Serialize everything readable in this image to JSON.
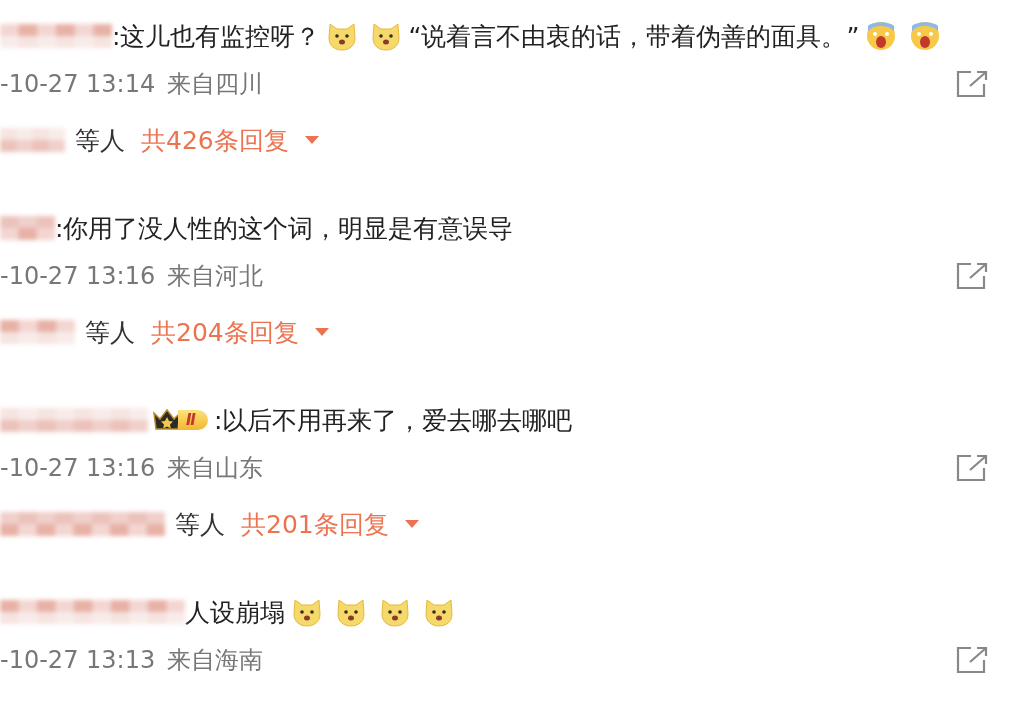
{
  "comments": [
    {
      "content": [
        {
          "kind": "text",
          "text": ":这儿也有监控呀？"
        },
        {
          "kind": "dog"
        },
        {
          "kind": "dog"
        },
        {
          "kind": "text",
          "text": "“说着言不由衷的话，带着伪善的面具。”"
        },
        {
          "kind": "scream"
        },
        {
          "kind": "scream"
        }
      ],
      "time": "-10-27 13:14",
      "location": "来自四川",
      "replies": {
        "suffix": "等人",
        "count": "共426条回复"
      }
    },
    {
      "content": [
        {
          "kind": "text",
          "text": ":你用了没人性的这个词，明显是有意误导"
        }
      ],
      "time": "-10-27 13:16",
      "location": "来自河北",
      "replies": {
        "suffix": "等人",
        "count": "共204条回复"
      }
    },
    {
      "badge": {
        "label": "Ⅱ"
      },
      "content": [
        {
          "kind": "text",
          "text": ":以后不用再来了，爱去哪去哪吧"
        }
      ],
      "time": "-10-27 13:16",
      "location": "来自山东",
      "replies": {
        "suffix": "等人",
        "count": "共201条回复"
      }
    },
    {
      "content": [
        {
          "kind": "text",
          "text": "人设崩塌"
        },
        {
          "kind": "dog"
        },
        {
          "kind": "dog"
        },
        {
          "kind": "dog"
        },
        {
          "kind": "dog"
        }
      ],
      "time": "-10-27 13:13",
      "location": "来自海南"
    }
  ]
}
